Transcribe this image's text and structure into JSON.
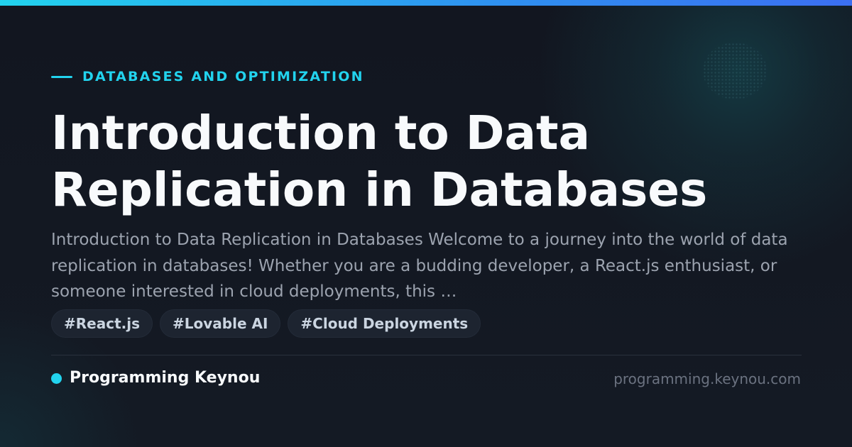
{
  "colors": {
    "accent": "#22d3ee",
    "accent_end": "#3b6ff2",
    "background": "#12161f",
    "title": "#f8fafc",
    "excerpt": "#9ca3af",
    "tag_bg": "#1d2430",
    "tag_text": "#cbd5e1",
    "muted": "#6b7280"
  },
  "post": {
    "category": "DATABASES AND OPTIMIZATION",
    "title": "Introduction to Data Replication in Databases",
    "excerpt": "Introduction to Data Replication in Databases Welcome to a journey into the world of data replication in databases! Whether you are a budding developer, a React.js enthusiast, or someone interested in cloud deployments, this …",
    "tags": [
      "#React.js",
      "#Lovable AI",
      "#Cloud Deployments"
    ]
  },
  "footer": {
    "brand_name": "Programming Keynou",
    "site_url": "programming.keynou.com"
  }
}
